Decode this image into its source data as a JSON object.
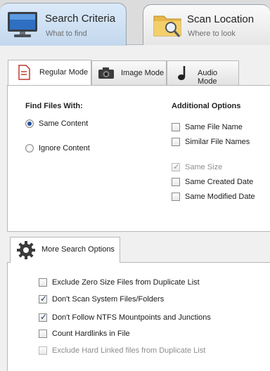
{
  "top_tabs": [
    {
      "title": "Search Criteria",
      "subtitle": "What to find",
      "icon": "monitor-icon",
      "active": true
    },
    {
      "title": "Scan Location",
      "subtitle": "Where to look",
      "icon": "folder-search-icon",
      "active": false
    }
  ],
  "mode_tabs": [
    {
      "label": "Regular Mode",
      "icon": "document-icon",
      "active": true
    },
    {
      "label": "Image Mode",
      "icon": "camera-icon",
      "active": false
    },
    {
      "label": "Audio Mode",
      "icon": "music-note-icon",
      "active": false
    }
  ],
  "find_files": {
    "heading": "Find Files With:",
    "options": [
      {
        "label": "Same Content",
        "selected": true
      },
      {
        "label": "Ignore Content",
        "selected": false
      }
    ]
  },
  "additional": {
    "heading": "Additional Options",
    "options": [
      {
        "label": "Same File Name",
        "checked": false,
        "enabled": true
      },
      {
        "label": "Similar File Names",
        "checked": false,
        "enabled": true
      },
      {
        "label": "Same Size",
        "checked": true,
        "enabled": false
      },
      {
        "label": "Same Created Date",
        "checked": false,
        "enabled": true
      },
      {
        "label": "Same Modified Date",
        "checked": false,
        "enabled": true
      }
    ]
  },
  "more": {
    "tab_label": "More Search Options",
    "options": [
      {
        "label": "Exclude Zero Size Files from Duplicate List",
        "checked": false,
        "enabled": true
      },
      {
        "label": "Don't Scan System Files/Folders",
        "checked": true,
        "enabled": true
      },
      {
        "label": "Don't Follow NTFS Mountpoints and Junctions",
        "checked": true,
        "enabled": true
      },
      {
        "label": "Count Hardlinks in File",
        "checked": false,
        "enabled": true
      },
      {
        "label": "Exclude Hard Linked files from Duplicate List",
        "checked": false,
        "enabled": false
      }
    ]
  },
  "check_glyph": "✓",
  "colors": {
    "accent": "#22519b",
    "active_tab": "#c3d8ee",
    "disabled_text": "#8d8d8d"
  }
}
